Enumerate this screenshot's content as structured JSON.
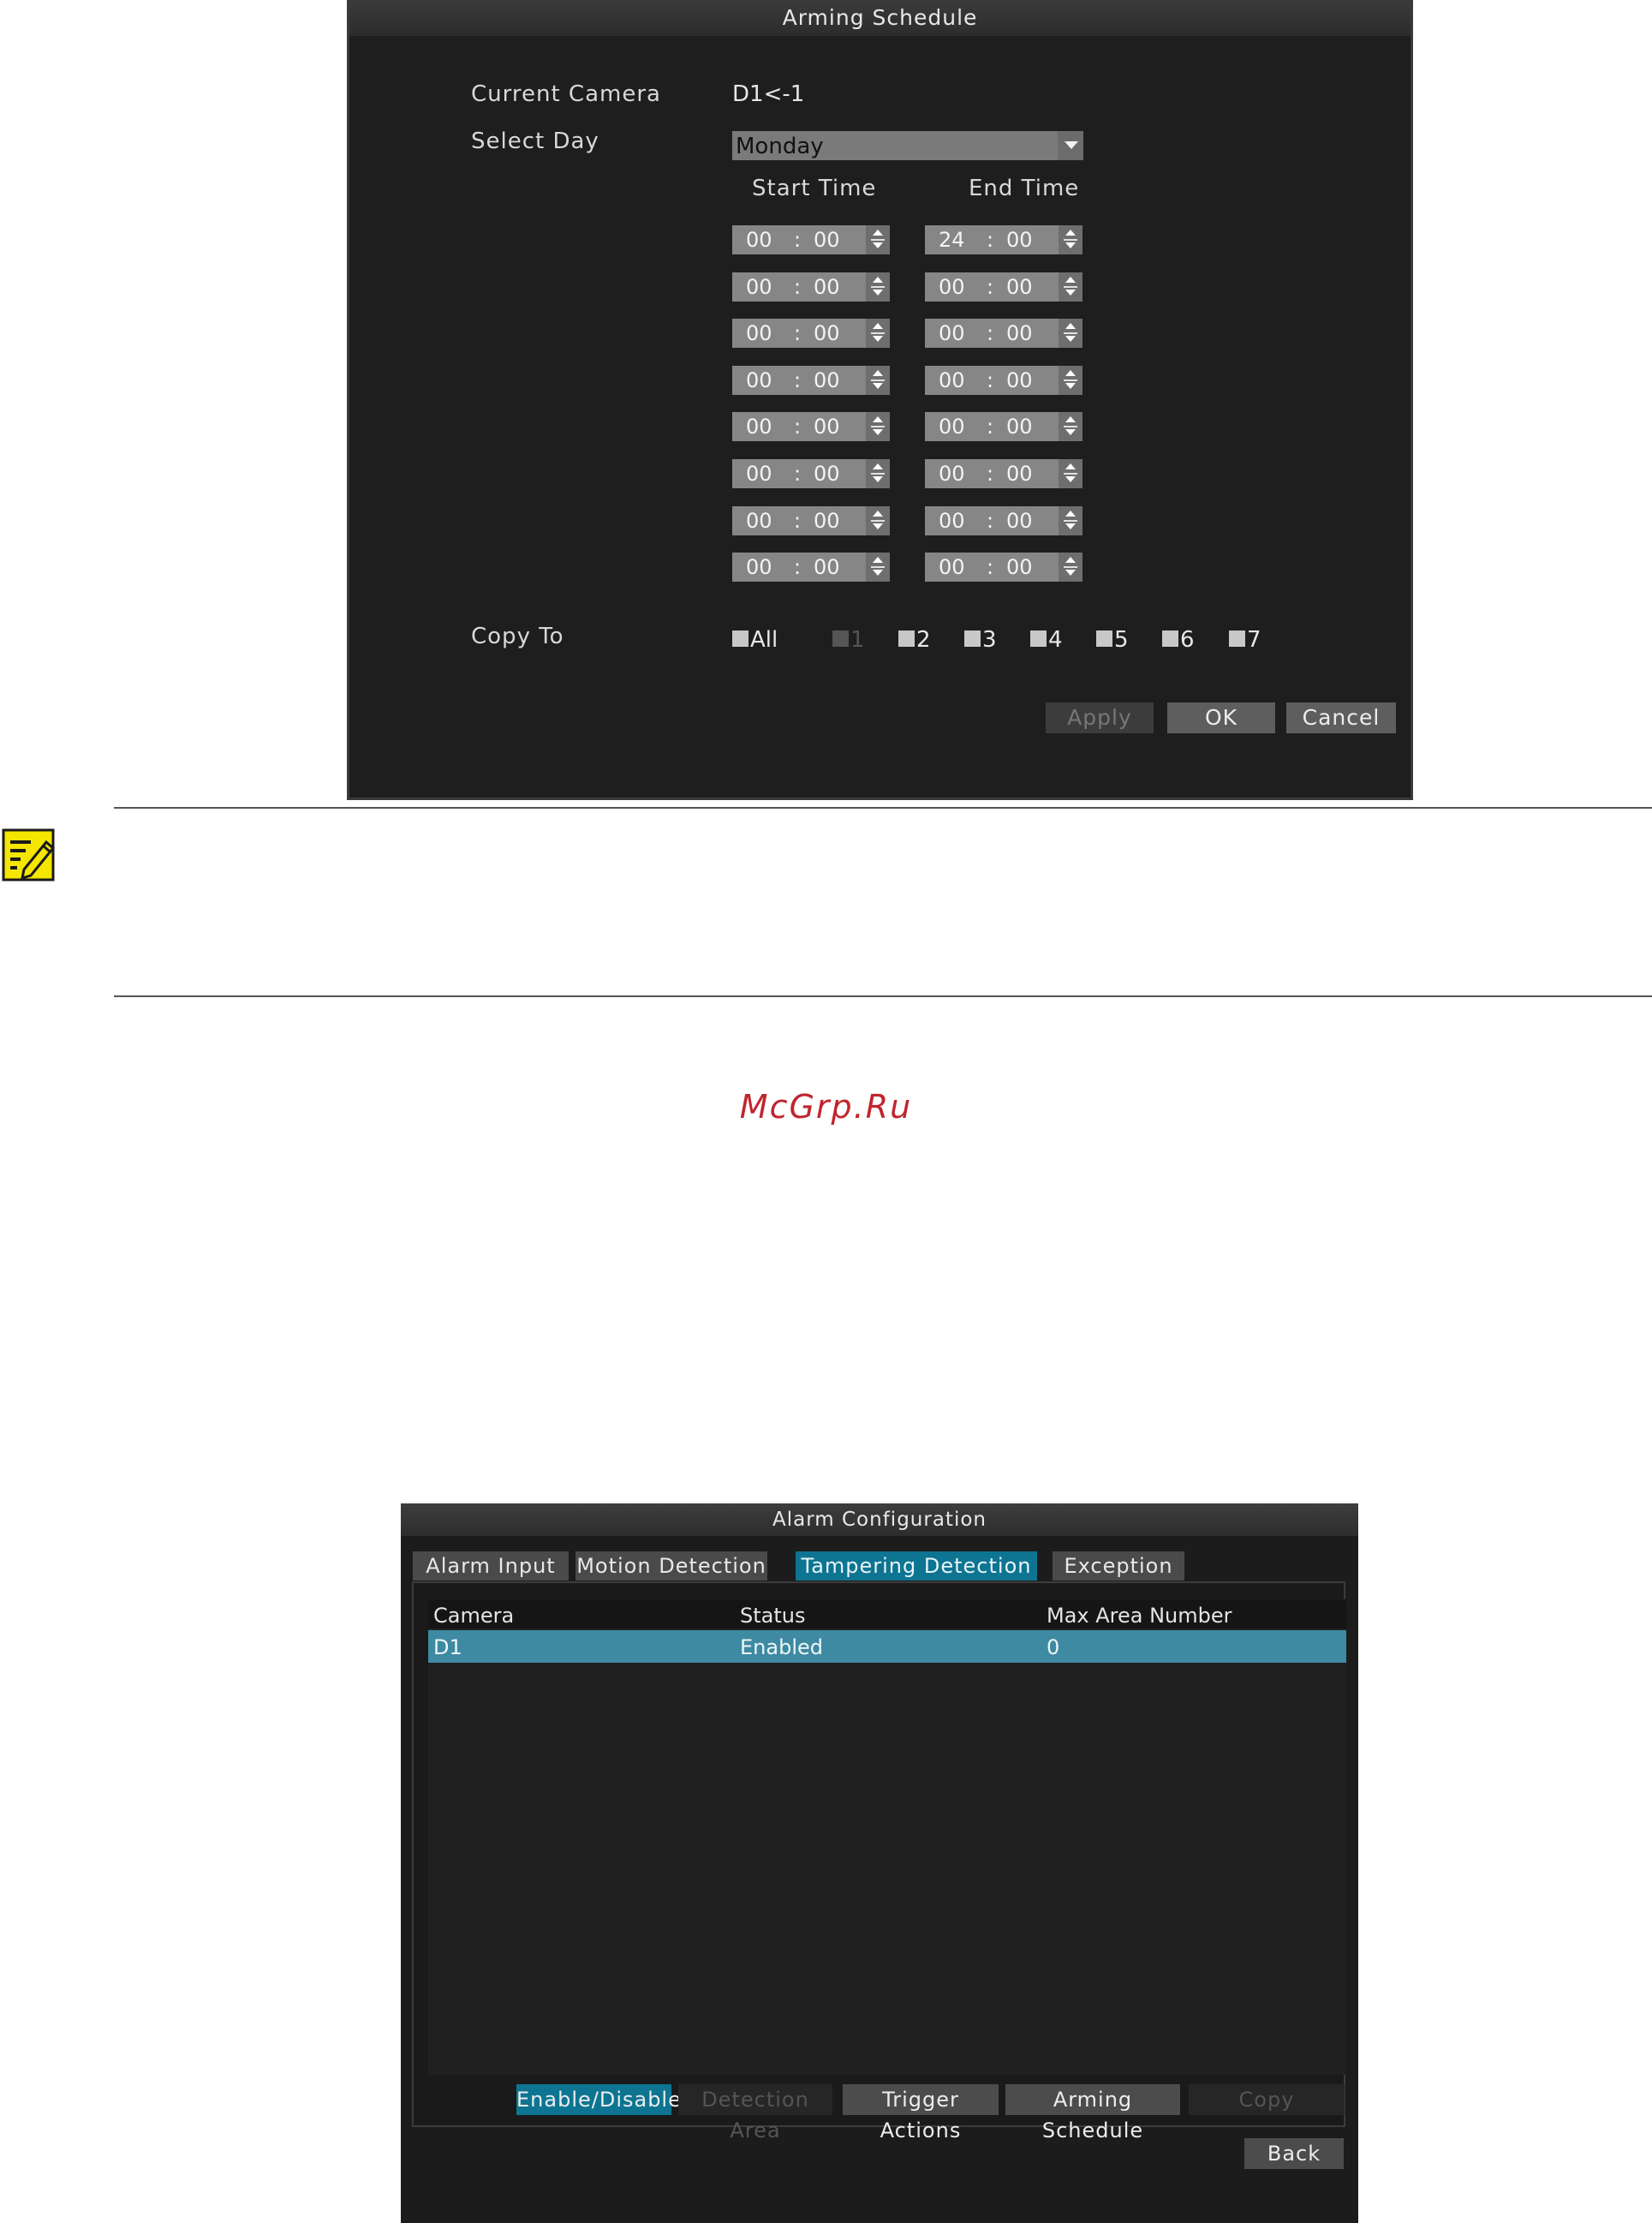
{
  "arming_schedule": {
    "title": "Arming Schedule",
    "current_camera_label": "Current Camera",
    "current_camera_value": "D1<-1",
    "select_day_label": "Select Day",
    "select_day_value": "Monday",
    "start_time_header": "Start Time",
    "end_time_header": "End Time",
    "time_separator": ":",
    "periods": [
      {
        "start_h": "00",
        "start_m": "00",
        "end_h": "24",
        "end_m": "00"
      },
      {
        "start_h": "00",
        "start_m": "00",
        "end_h": "00",
        "end_m": "00"
      },
      {
        "start_h": "00",
        "start_m": "00",
        "end_h": "00",
        "end_m": "00"
      },
      {
        "start_h": "00",
        "start_m": "00",
        "end_h": "00",
        "end_m": "00"
      },
      {
        "start_h": "00",
        "start_m": "00",
        "end_h": "00",
        "end_m": "00"
      },
      {
        "start_h": "00",
        "start_m": "00",
        "end_h": "00",
        "end_m": "00"
      },
      {
        "start_h": "00",
        "start_m": "00",
        "end_h": "00",
        "end_m": "00"
      },
      {
        "start_h": "00",
        "start_m": "00",
        "end_h": "00",
        "end_m": "00"
      }
    ],
    "copy_to_label": "Copy To",
    "copy_to_options": [
      {
        "label": "All",
        "disabled": false
      },
      {
        "label": "1",
        "disabled": true
      },
      {
        "label": "2",
        "disabled": false
      },
      {
        "label": "3",
        "disabled": false
      },
      {
        "label": "4",
        "disabled": false
      },
      {
        "label": "5",
        "disabled": false
      },
      {
        "label": "6",
        "disabled": false
      },
      {
        "label": "7",
        "disabled": false
      }
    ],
    "apply_label": "Apply",
    "ok_label": "OK",
    "cancel_label": "Cancel"
  },
  "note": {
    "icon": "note-pencil-icon",
    "icon_color": "#f5e600"
  },
  "watermark": "McGrp.Ru",
  "alarm_configuration": {
    "title": "Alarm Configuration",
    "tabs": [
      {
        "label": "Alarm Input",
        "active": false
      },
      {
        "label": "Motion Detection",
        "active": false
      },
      {
        "label": "Tampering Detection",
        "active": true
      },
      {
        "label": "Exception",
        "active": false
      }
    ],
    "table": {
      "headers": [
        "Camera",
        "Status",
        "Max Area Number"
      ],
      "rows": [
        [
          "D1",
          "Enabled",
          "0"
        ]
      ]
    },
    "actions": {
      "enable_disable": "Enable/Disable",
      "detection_area": "Detection Area",
      "trigger_actions": "Trigger Actions",
      "arming_schedule": "Arming Schedule",
      "copy": "Copy"
    },
    "back_label": "Back",
    "accent_color": "#0d7592"
  }
}
